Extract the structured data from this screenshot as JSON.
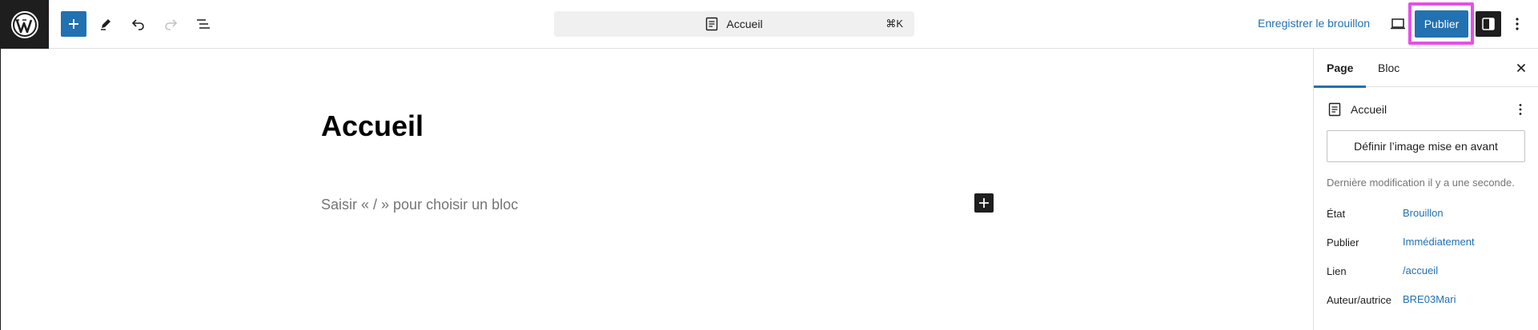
{
  "toolbar": {
    "add_block_icon": "plus-icon",
    "tools_icon": "pencil-icon",
    "undo_icon": "undo-icon",
    "redo_icon": "redo-icon",
    "list_view_icon": "list-view-icon"
  },
  "document_bar": {
    "title": "Accueil",
    "shortcut": "⌘K"
  },
  "actions": {
    "save_draft_label": "Enregistrer le brouillon",
    "publish_label": "Publier"
  },
  "editor": {
    "post_title": "Accueil",
    "block_placeholder": "Saisir « / » pour choisir un bloc"
  },
  "sidebar": {
    "tabs": [
      {
        "label": "Page",
        "active": true
      },
      {
        "label": "Bloc",
        "active": false
      }
    ],
    "page_name": "Accueil",
    "featured_image_label": "Définir l’image mise en avant",
    "last_modified": "Dernière modification il y a une seconde.",
    "properties": [
      {
        "key": "État",
        "value": "Brouillon"
      },
      {
        "key": "Publier",
        "value": "Immédiatement"
      },
      {
        "key": "Lien",
        "value": "/accueil"
      },
      {
        "key": "Auteur/au­trice",
        "value": "BRE03Mari"
      }
    ]
  },
  "colors": {
    "accent": "#2271b1",
    "highlight": "#e64fe8",
    "dark": "#1e1e1e"
  }
}
